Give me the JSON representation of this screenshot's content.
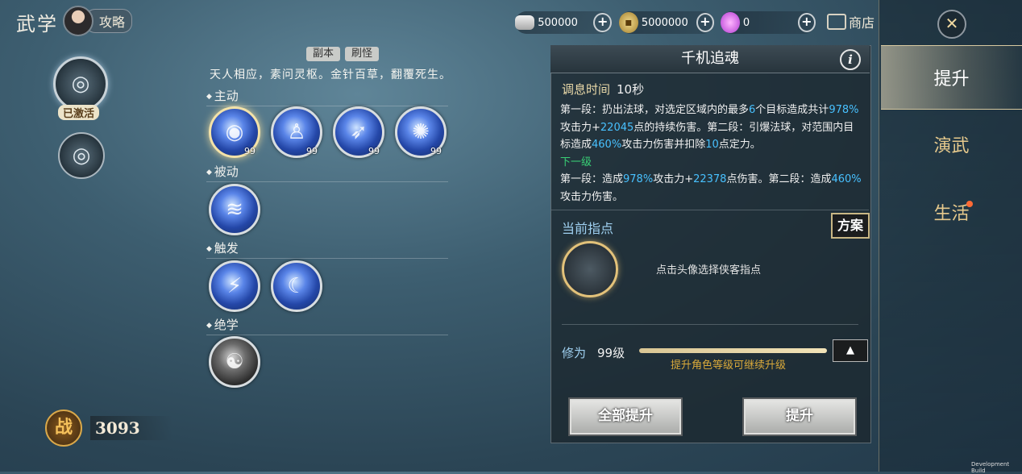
{
  "header": {
    "title": "武学",
    "guide_label": "攻略",
    "currencies": [
      {
        "icon": "silver-ingot-icon",
        "value": "500000"
      },
      {
        "icon": "gold-coin-icon",
        "value": "5000000"
      },
      {
        "icon": "purple-gem-icon",
        "value": "0"
      }
    ],
    "shop_label": "商店"
  },
  "tabs": [
    {
      "label": "提升",
      "active": true
    },
    {
      "label": "演武",
      "active": false
    },
    {
      "label": "生活",
      "active": false,
      "badge": true
    }
  ],
  "sidebar": {
    "activated_label": "已激活",
    "power_seal": "战",
    "power_value": "3093"
  },
  "skills": {
    "tags": [
      "副本",
      "刷怪"
    ],
    "motto": "天人相应，素问灵枢。金针百草，翻覆死生。",
    "sections": [
      {
        "title": "主动",
        "skills": [
          {
            "level": "99"
          },
          {
            "level": "99"
          },
          {
            "level": "99"
          },
          {
            "level": "99"
          }
        ]
      },
      {
        "title": "被动",
        "skills": [
          {
            "level": ""
          }
        ]
      },
      {
        "title": "触发",
        "skills": [
          {
            "level": ""
          },
          {
            "level": ""
          }
        ]
      },
      {
        "title": "绝学",
        "skills": [
          {
            "level": ""
          }
        ]
      }
    ]
  },
  "detail": {
    "title": "千机追魂",
    "tune_label": "调息时间",
    "tune_value": "10秒",
    "desc_parts": {
      "p1": "第一段：扔出法球，对选定区域内的最多",
      "n1": "6",
      "p2": "个目标造成共计",
      "n2": "978%",
      "p3": "攻击力+",
      "n3": "22045",
      "p4": "点的持续伤害。第二段：引爆法球，对范围内目标造成",
      "n4": "460%",
      "p5": "攻击力伤害并扣除",
      "n5": "10",
      "p6": "点定力。",
      "next_label": "下一级",
      "q1": "第一段：造成",
      "m1": "978%",
      "q2": "攻击力+",
      "m2": "22378",
      "q3": "点伤害。第二段：造成",
      "m3": "460%",
      "q4": "攻击力伤害。"
    },
    "guide_title": "当前指点",
    "plan_label": "方案",
    "mentor_hint": "点击头像选择侠客指点",
    "cultivation_label": "修为",
    "cultivation_level": "99级",
    "cultivation_progress": 1.0,
    "cultivation_hint": "提升角色等级可继续升级",
    "btn_all": "全部提升",
    "btn_up": "提升"
  },
  "footer": {
    "dev": "Development Build"
  }
}
